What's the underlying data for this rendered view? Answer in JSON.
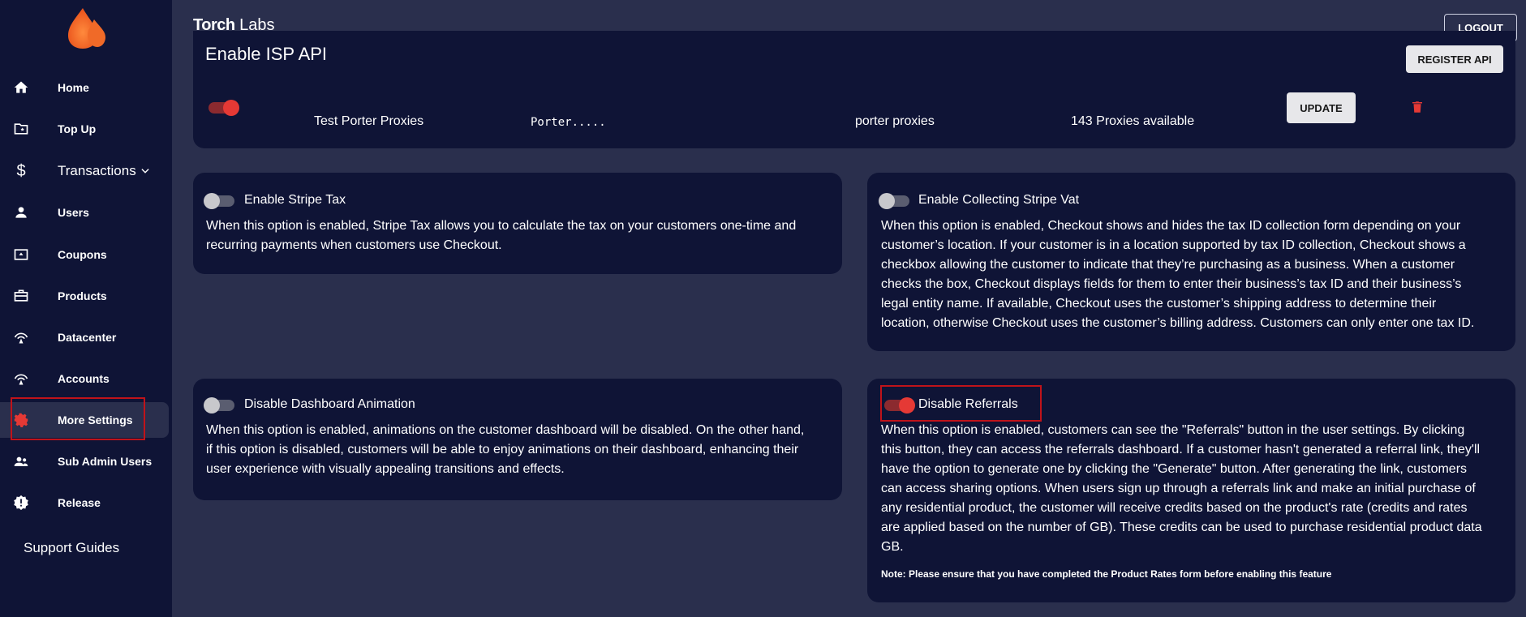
{
  "app": {
    "brand_bold": "Torch",
    "brand_regular": "Labs",
    "logout_label": "LOGOUT"
  },
  "sidebar": {
    "items": [
      {
        "label": "Home",
        "icon": "home-icon"
      },
      {
        "label": "Top Up",
        "icon": "folder-star-icon"
      },
      {
        "label": "Transactions",
        "icon": "dollar-icon"
      },
      {
        "label": "Users",
        "icon": "user-icon"
      },
      {
        "label": "Coupons",
        "icon": "coupon-icon"
      },
      {
        "label": "Products",
        "icon": "briefcase-icon"
      },
      {
        "label": "Datacenter",
        "icon": "wifi-tethering-icon"
      },
      {
        "label": "Accounts",
        "icon": "wifi-tethering-icon"
      },
      {
        "label": "More Settings",
        "icon": "gear-icon"
      },
      {
        "label": "Sub Admin Users",
        "icon": "users-icon"
      },
      {
        "label": "Release",
        "icon": "badge-alert-icon"
      }
    ],
    "support_label": "Support Guides",
    "active": "More Settings",
    "accent_color": "#e53935"
  },
  "isp": {
    "title": "Enable ISP API",
    "register_label": "REGISTER API",
    "row": {
      "enabled": true,
      "name": "Test Porter Proxies",
      "key": "Porter.....",
      "provider": "porter proxies",
      "available": "143 Proxies available",
      "update_label": "UPDATE"
    }
  },
  "options": {
    "stripe_tax": {
      "enabled": false,
      "title": "Enable Stripe Tax",
      "desc_lines": [
        "When this option is enabled, Stripe Tax allows you to calculate the tax on your customers one-time and",
        "recurring payments when customers use Checkout."
      ]
    },
    "stripe_vat": {
      "enabled": false,
      "title": "Enable Collecting Stripe Vat",
      "desc_lines": [
        "When this option is enabled, Checkout shows and hides the tax ID collection form depending on your",
        "customer’s location. If your customer is in a location supported by tax ID collection, Checkout shows a",
        "checkbox allowing the customer to indicate that they’re purchasing as a business. When a customer",
        "checks the box, Checkout displays fields for them to enter their business’s tax ID and their business’s",
        "legal entity name. If available, Checkout uses the customer’s shipping address to determine their",
        "location, otherwise Checkout uses the customer’s billing address. Customers can only enter one tax ID."
      ]
    },
    "dashboard_animation": {
      "enabled": false,
      "title": "Disable Dashboard Animation",
      "desc_lines": [
        "When this option is enabled, animations on the customer dashboard will be disabled. On the other hand,",
        "if this option is disabled, customers will be able to enjoy animations on their dashboard, enhancing their",
        "user experience with visually appealing transitions and effects."
      ]
    },
    "referrals": {
      "enabled": true,
      "title": "Disable Referrals",
      "desc_lines": [
        "When this option is enabled, customers can see the \"Referrals\" button in the user settings. By clicking",
        "this button, they can access the referrals dashboard. If a customer hasn't generated a referral link, they'll",
        "have the option to generate one by clicking the \"Generate\" button. After generating the link, customers",
        "can access sharing options. When users sign up through a referrals link and make an initial purchase of",
        "any residential product, the customer will receive credits based on the product's rate (credits and rates",
        "are applied based on the number of GB). These credits can be used to purchase residential product data",
        "GB."
      ],
      "note": "Note: Please ensure that you have completed the Product Rates form before enabling this feature"
    }
  }
}
